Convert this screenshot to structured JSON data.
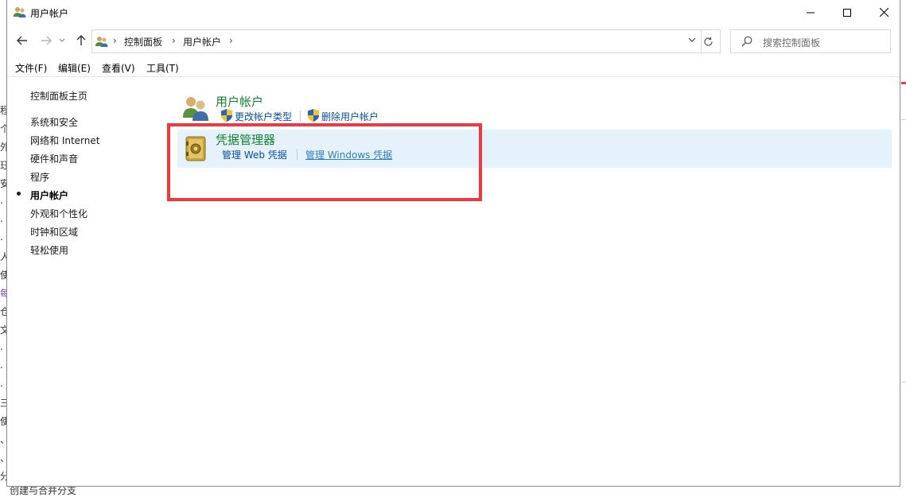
{
  "window": {
    "title": "用户帐户"
  },
  "caption_buttons": {
    "minimize": "—",
    "maximize": "☐",
    "close": "✕"
  },
  "address": {
    "breadcrumbs": [
      "控制面板",
      "用户帐户"
    ],
    "separator": "›",
    "search_placeholder": "搜索控制面板"
  },
  "menu": {
    "items": [
      "文件(F)",
      "编辑(E)",
      "查看(V)",
      "工具(T)"
    ]
  },
  "sidebar": {
    "home": "控制面板主页",
    "items": [
      {
        "label": "系统和安全",
        "active": false
      },
      {
        "label": "网络和 Internet",
        "active": false
      },
      {
        "label": "硬件和声音",
        "active": false
      },
      {
        "label": "程序",
        "active": false
      },
      {
        "label": "用户帐户",
        "active": true
      },
      {
        "label": "外观和个性化",
        "active": false
      },
      {
        "label": "时钟和区域",
        "active": false
      },
      {
        "label": "轻松使用",
        "active": false
      }
    ]
  },
  "main": {
    "accounts": {
      "title": "用户帐户",
      "links": [
        "更改帐户类型",
        "删除用户帐户"
      ]
    },
    "credentials": {
      "title": "凭据管理器",
      "links": [
        "管理 Web 凭据",
        "管理 Windows 凭据"
      ]
    }
  },
  "background": {
    "left_chars": [
      "程",
      "个",
      "外",
      "珏",
      "安",
      ".",
      ".",
      ".",
      "人",
      "使",
      "每",
      "仓",
      "文",
      ".",
      ".",
      ".",
      "三",
      "使",
      "、",
      "、",
      "分"
    ],
    "bottom_text": "创建与合并分支"
  },
  "colors": {
    "link": "#0a4ea3",
    "section_title": "#13852e",
    "hover_bg": "#e5f1fb",
    "highlight": "#f1383f"
  }
}
